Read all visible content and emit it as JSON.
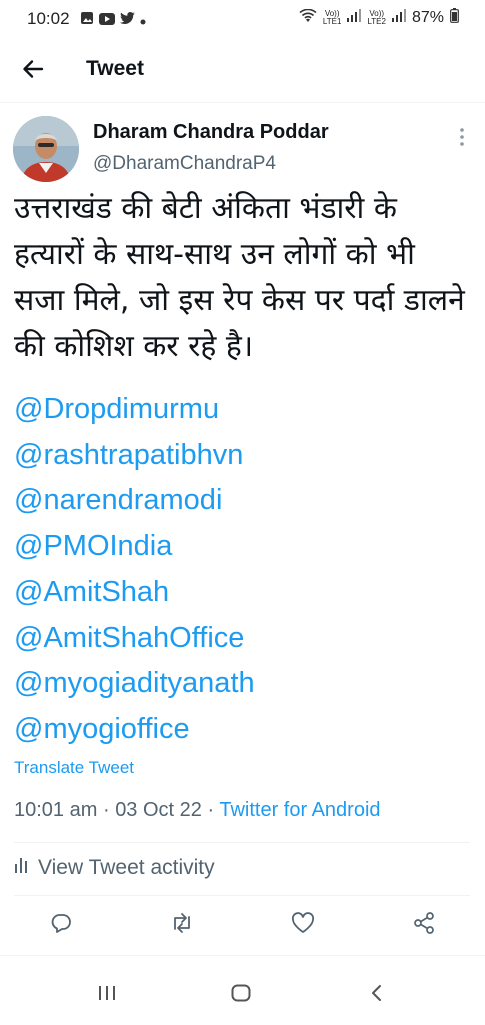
{
  "status_bar": {
    "time": "10:02",
    "sim1_label_top": "Vo))",
    "sim1_label_bottom": "LTE1",
    "sim2_label_top": "Vo))",
    "sim2_label_bottom": "LTE2",
    "battery": "87%"
  },
  "header": {
    "title": "Tweet"
  },
  "tweet": {
    "author_name": "Dharam Chandra Poddar",
    "author_handle": "@DharamChandraP4",
    "text": "उत्तराखंड की बेटी अंकिता भंडारी के हत्यारों के साथ-साथ उन लोगों को भी सजा मिले, जो इस रेप केस पर पर्दा डालने की कोशिश कर रहे है।",
    "mentions": [
      "@Dropdimurmu",
      "@rashtrapatibhvn",
      "@narendramodi",
      "@PMOIndia",
      "@AmitShah",
      "@AmitShahOffice",
      "@myogiadityanath",
      "@myogioffice"
    ],
    "translate_label": "Translate Tweet",
    "time": "10:01 am",
    "separator": "·",
    "date": "03 Oct 22",
    "client": "Twitter for Android",
    "activity_label": "View Tweet activity"
  },
  "icons": {
    "back": "arrow-left-icon",
    "more": "vertical-dots-icon",
    "reply": "comment-icon",
    "retweet": "retweet-icon",
    "like": "heart-icon",
    "share": "share-icon",
    "activity": "bar-chart-icon"
  },
  "colors": {
    "accent": "#1d9bf0",
    "secondary": "#536471"
  }
}
